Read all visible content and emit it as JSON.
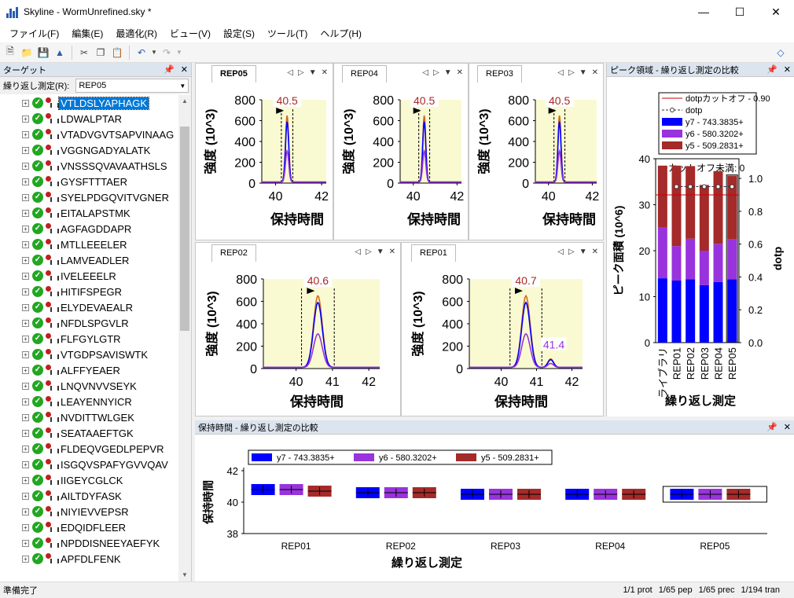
{
  "window": {
    "title": "Skyline - WormUnrefined.sky *"
  },
  "menu": [
    "ファイル(F)",
    "編集(E)",
    "最適化(R)",
    "ビュー(V)",
    "設定(S)",
    "ツール(T)",
    "ヘルプ(H)"
  ],
  "targets": {
    "header": "ターゲット",
    "replicate_label": "繰り返し測定(R):",
    "replicate_value": "REP05",
    "peptides": [
      "VTLDSLYAPHAGK",
      "LDWALPTAR",
      "VTADVGVTSAPVINAAG",
      "VGGNGADYALATK",
      "VNSSSQVAVAATHSLS",
      "GYSFTTTAER",
      "SYELPDGQVITVGNER",
      "EITALAPSTMK",
      "AGFAGDDAPR",
      "MTLLEEELER",
      "LAMVEADLER",
      "IVELEEELR",
      "HITIFSPEGR",
      "ELYDEVAEALR",
      "NFDLSPGVLR",
      "FLFGYLGTR",
      "VTGDPSAVISWTK",
      "ALFFYEAER",
      "LNQVNVVSEYK",
      "LEAYENNYICR",
      "NVDITTWLGEK",
      "SEATAAEFTGK",
      "FLDEQVGEDLPEPVR",
      "ISGQVSPAFYGVVQAV",
      "IIGEYCGLCK",
      "AILTDYFASK",
      "NIYIEVVEPSR",
      "EDQIDFLEER",
      "NPDDISNEEYAEFYK",
      "APFDLFENK"
    ]
  },
  "chromatograms": [
    {
      "tab": "REP05",
      "active": true,
      "peak_label": "40.5",
      "ylabel": "強度 (10^3)",
      "xlabel": "保持時間",
      "yticks": [
        "800",
        "600",
        "400",
        "200",
        "0"
      ],
      "xticks": [
        "40",
        "42"
      ]
    },
    {
      "tab": "REP04",
      "active": false,
      "peak_label": "40.5",
      "ylabel": "強度 (10^3)",
      "xlabel": "保持時間",
      "yticks": [
        "800",
        "600",
        "400",
        "200",
        "0"
      ],
      "xticks": [
        "40",
        "42"
      ]
    },
    {
      "tab": "REP03",
      "active": false,
      "peak_label": "40.5",
      "ylabel": "強度 (10^3)",
      "xlabel": "保持時間",
      "yticks": [
        "800",
        "600",
        "400",
        "200",
        "0"
      ],
      "xticks": [
        "40",
        "42"
      ]
    },
    {
      "tab": "REP02",
      "active": false,
      "peak_label": "40.6",
      "ylabel": "強度 (10^3)",
      "xlabel": "保持時間",
      "yticks": [
        "800",
        "600",
        "400",
        "200",
        "0"
      ],
      "xticks": [
        "40",
        "41",
        "42"
      ]
    },
    {
      "tab": "REP01",
      "active": false,
      "peak_label": "40.7",
      "peak_label2": "41.4",
      "ylabel": "強度 (10^3)",
      "xlabel": "保持時間",
      "yticks": [
        "800",
        "600",
        "400",
        "200",
        "0"
      ],
      "xticks": [
        "40",
        "41",
        "42"
      ]
    }
  ],
  "peak_area_panel": {
    "header": "ピーク領域 - 繰り返し測定の比較",
    "cutoff_text": "カットオフ未満: 0",
    "legend": [
      "dotpカットオフ - 0.90",
      "dotp",
      "y7 - 743.3835+",
      "y6 - 580.3202+",
      "y5 - 509.2831+"
    ],
    "colors": {
      "y7": "#0000ff",
      "y6": "#9933dd",
      "y5": "#a52a2a",
      "cutoff": "#cc0000"
    }
  },
  "chart_data": [
    {
      "type": "bar",
      "title": "",
      "categories": [
        "ライブラリ",
        "REP01",
        "REP02",
        "REP03",
        "REP04",
        "REP05"
      ],
      "series": [
        {
          "name": "y7 - 743.3835+",
          "values": [
            14,
            13.5,
            13.8,
            12.5,
            13.2,
            13.8
          ]
        },
        {
          "name": "y6 - 580.3202+",
          "values": [
            11,
            7.5,
            8.8,
            7.5,
            8.3,
            8.7
          ]
        },
        {
          "name": "y5 - 509.2831+",
          "values": [
            13.5,
            17.5,
            15.8,
            14.3,
            15.8,
            13.8
          ]
        }
      ],
      "dotp": [
        null,
        0.95,
        0.95,
        0.95,
        0.95,
        0.95
      ],
      "dotp_cutoff": 0.9,
      "xlabel": "繰り返し測定",
      "ylabel": "ピーク面積 (10^6)",
      "ylabel2": "dotp",
      "ylim": [
        0,
        40
      ],
      "yticks": [
        "0",
        "10",
        "20",
        "30",
        "40"
      ],
      "y2ticks": [
        "0.0",
        "0.2",
        "0.4",
        "0.6",
        "0.8",
        "1.0"
      ]
    },
    {
      "type": "box",
      "title": "保持時間 - 繰り返し測定の比較",
      "categories": [
        "REP01",
        "REP02",
        "REP03",
        "REP04",
        "REP05"
      ],
      "series": [
        {
          "name": "y7 - 743.3835+",
          "values": [
            40.8,
            40.6,
            40.5,
            40.5,
            40.5
          ]
        },
        {
          "name": "y6 - 580.3202+",
          "values": [
            40.8,
            40.6,
            40.5,
            40.5,
            40.5
          ]
        },
        {
          "name": "y5 - 509.2831+",
          "values": [
            40.7,
            40.6,
            40.5,
            40.5,
            40.5
          ]
        }
      ],
      "xlabel": "繰り返し測定",
      "ylabel": "保持時間",
      "ylim": [
        38,
        42
      ],
      "yticks": [
        "42",
        "40",
        "38"
      ]
    }
  ],
  "status": {
    "text": "準備完了",
    "prot": "1/1 prot",
    "pep": "1/65 pep",
    "prec": "1/65 prec",
    "tran": "1/194 tran"
  }
}
